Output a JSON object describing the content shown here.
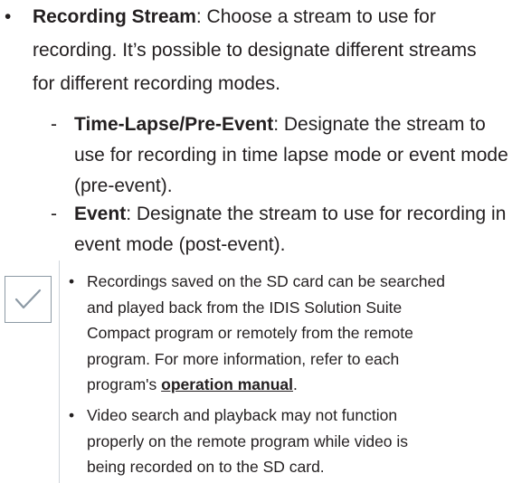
{
  "recording_stream": {
    "bullet": "•",
    "term": "Recording Stream",
    "line1_rest": ": Choose a stream to use for",
    "line2": "recording. It’s possible to designate different streams",
    "line3": "for different recording modes."
  },
  "sub_items": [
    {
      "dash": "-",
      "term": "Time-Lapse/Pre-Event",
      "line1_rest": ": Designate the stream to",
      "line2": "use for recording in time lapse mode or event mode",
      "line3": "(pre-event)."
    },
    {
      "dash": "-",
      "term": "Event",
      "line1_rest": ": Designate the stream to use for recording in",
      "line2": "event mode (post-event)."
    }
  ],
  "note": {
    "icon": "checkmark-icon",
    "items": [
      {
        "bullet": "•",
        "line1": "Recordings saved on the SD card can be searched",
        "line2": "and played back from the IDIS Solution Suite",
        "line3": "Compact program or remotely from the remote",
        "line4": "program. For more information, refer to each",
        "line5_pre": "program's ",
        "line5_link": "operation manual",
        "line5_post": "."
      },
      {
        "bullet": "•",
        "line1": "Video search and playback may not function",
        "line2": "properly on the remote program while video is",
        "line3": "being recorded on to the SD card."
      }
    ]
  },
  "colors": {
    "text": "#231f20",
    "icon_border": "#8d9aa5",
    "checkmark": "#8d9aa5"
  }
}
